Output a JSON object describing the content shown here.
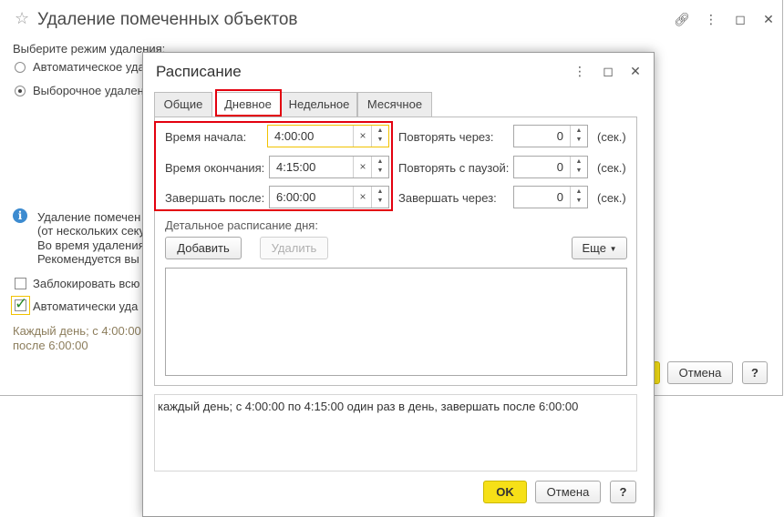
{
  "bg_window": {
    "title": "Удаление помеченных объектов",
    "prompt": "Выберите режим удаления:",
    "radio_auto": "Автоматическое уда",
    "radio_select": "Выборочное удален",
    "info_lines": [
      "Удаление помечен",
      "(от нескольких секу",
      "Во время удаления",
      "Рекомендуется вы"
    ],
    "check_lock": "Заблокировать всю",
    "check_auto": "Автоматически уда",
    "schedule_line1": "Каждый день; с 4:00:00",
    "schedule_line2": "после 6:00:00",
    "cancel_label": "Отмена",
    "help_label": "?"
  },
  "dialog": {
    "title": "Расписание",
    "tabs": [
      {
        "label": "Общие",
        "active": false
      },
      {
        "label": "Дневное",
        "active": true
      },
      {
        "label": "Недельное",
        "active": false
      },
      {
        "label": "Месячное",
        "active": false
      }
    ],
    "fields": {
      "start_label": "Время начала:",
      "start_value": "4:00:00",
      "end_label": "Время окончания:",
      "end_value": "4:15:00",
      "finish_label": "Завершать после:",
      "finish_value": "6:00:00",
      "repeat_label": "Повторять через:",
      "repeat_value": "0",
      "pause_label": "Повторять с паузой:",
      "pause_value": "0",
      "finish_in_label": "Завершать через:",
      "finish_in_value": "0",
      "unit": "(сек.)"
    },
    "detail_label": "Детальное расписание дня:",
    "add_label": "Добавить",
    "delete_label": "Удалить",
    "more_label": "Еще",
    "summary": "каждый день; с 4:00:00 по 4:15:00 один раз в день, завершать после 6:00:00",
    "ok_label": "OK",
    "cancel_label": "Отмена",
    "help_label": "?",
    "clear_glyph": "×"
  }
}
